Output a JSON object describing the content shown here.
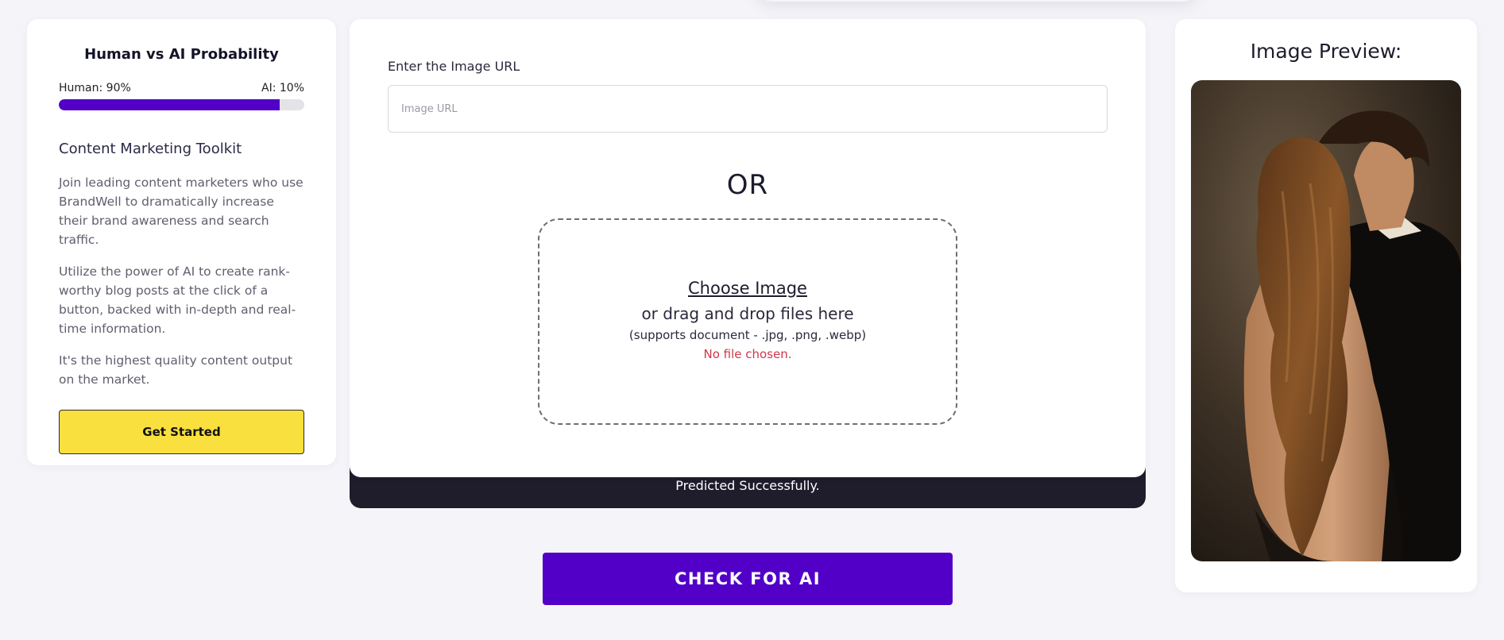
{
  "probability": {
    "title": "Human vs AI Probability",
    "human_label": "Human: 90%",
    "ai_label": "AI: 10%",
    "human_fraction": 0.9,
    "bar_color": "#5200c8"
  },
  "toolkit": {
    "title": "Content Marketing Toolkit",
    "paragraphs": [
      "Join leading content marketers who use BrandWell to dramatically increase their brand awareness and search traffic.",
      "Utilize the power of AI to create rank-worthy blog posts at the click of a button, backed with in-depth and real-time information.",
      "It's the highest quality content output on the market."
    ],
    "button_label": "Get Started"
  },
  "upload": {
    "url_label": "Enter the Image URL",
    "url_placeholder": "Image URL",
    "url_value": "",
    "or_text": "OR",
    "choose_label": "Choose Image",
    "drag_text": "or drag and drop files here",
    "supports_text": "(supports document - .jpg, .png, .webp)",
    "file_status": "No file chosen.",
    "status_message": "Predicted Successfully."
  },
  "actions": {
    "check_label": "CHECK FOR AI"
  },
  "preview": {
    "title": "Image Preview:",
    "image_icon": "photo-couple-icon"
  },
  "colors": {
    "accent": "#5200c8",
    "cta_yellow": "#f9e03f",
    "error": "#d0364a",
    "status_bar": "#1f1c2c"
  }
}
